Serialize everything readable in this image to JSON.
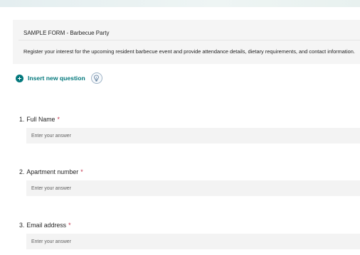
{
  "form": {
    "title": "SAMPLE FORM - Barbecue Party",
    "description": "Register your interest for the upcoming resident barbecue event and provide attendance details, dietary requirements, and contact information."
  },
  "toolbar": {
    "insert_label": "Insert new question",
    "insert_icon": "plus-circle-icon",
    "copilot_icon": "lightbulb-icon",
    "accent": "#03787c"
  },
  "questions": [
    {
      "number": "1.",
      "label": "Full Name",
      "required_mark": "*",
      "placeholder": "Enter your answer"
    },
    {
      "number": "2.",
      "label": "Apartment number",
      "required_mark": "*",
      "placeholder": "Enter your answer"
    },
    {
      "number": "3.",
      "label": "Email address",
      "required_mark": "*",
      "placeholder": "Enter your answer"
    }
  ],
  "colors": {
    "required": "#c4314b",
    "card_background": "#f5f5f5",
    "input_background": "#f3f3f3"
  }
}
